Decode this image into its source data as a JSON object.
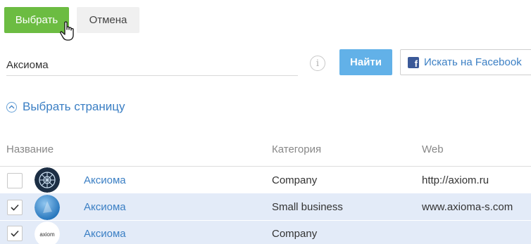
{
  "toolbar": {
    "select_label": "Выбрать",
    "cancel_label": "Отмена"
  },
  "search": {
    "value": "Аксиома",
    "find_label": "Найти",
    "facebook_label": "Искать на Facebook",
    "info_glyph": "i"
  },
  "toggle": {
    "label": "Выбрать страницу"
  },
  "table": {
    "headers": {
      "name": "Название",
      "category": "Категория",
      "web": "Web"
    },
    "rows": [
      {
        "checked": false,
        "name": "Аксиома",
        "category": "Company",
        "web": "http://axiom.ru",
        "avatar": "dark-sphere"
      },
      {
        "checked": true,
        "name": "Аксиома",
        "category": "Small business",
        "web": "www.axioma-s.com",
        "avatar": "blue-sphere"
      },
      {
        "checked": true,
        "name": "Аксиома",
        "category": "Company",
        "web": "",
        "avatar": "axiom-text-logo",
        "avatar_text": "axiom"
      }
    ]
  },
  "colors": {
    "select_button": "#6cbc42",
    "find_button": "#62b1e8",
    "link": "#3b7fc4",
    "selected_row": "#e3ebf8",
    "facebook": "#3b5998"
  }
}
